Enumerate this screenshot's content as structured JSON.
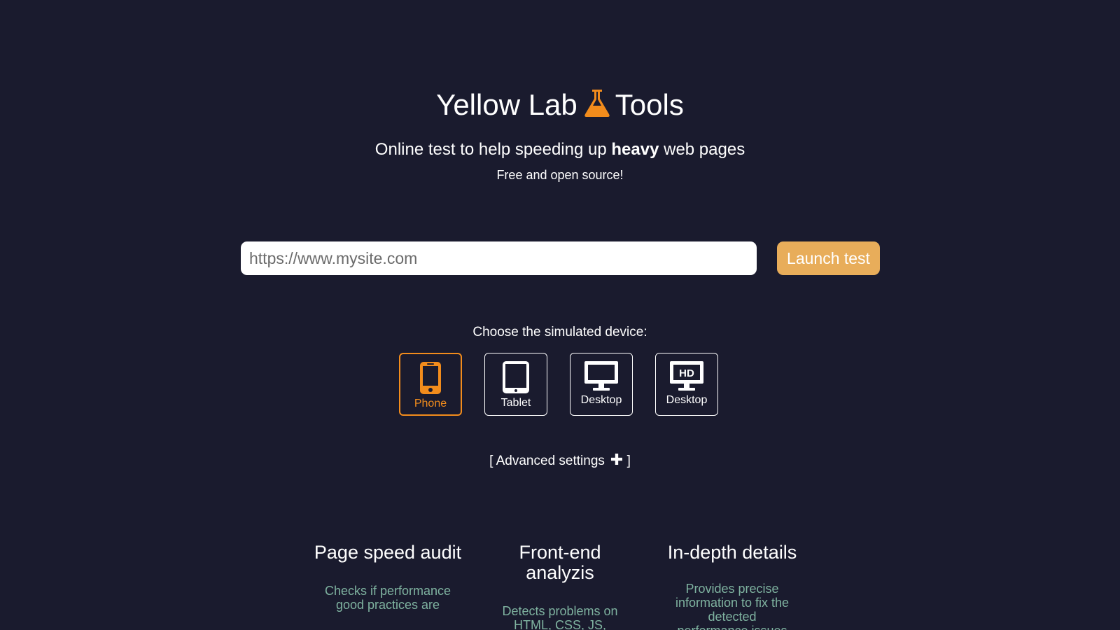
{
  "header": {
    "title_part1": "Yellow Lab",
    "title_part2": "Tools",
    "subtitle_prefix": "Online test to help speeding up ",
    "subtitle_bold": "heavy",
    "subtitle_suffix": " web pages",
    "tagline": "Free and open source!"
  },
  "search": {
    "placeholder": "https://www.mysite.com",
    "value": "",
    "launch_label": "Launch test"
  },
  "devices": {
    "label": "Choose the simulated device:",
    "selected": "Phone",
    "items": [
      {
        "label": "Phone",
        "icon": "phone-icon"
      },
      {
        "label": "Tablet",
        "icon": "tablet-icon"
      },
      {
        "label": "Desktop",
        "icon": "desktop-icon"
      },
      {
        "label": "Desktop",
        "icon": "desktop-hd-icon",
        "badge": "HD"
      }
    ]
  },
  "advanced": {
    "open": "[",
    "label": "Advanced settings",
    "icon": "plus-icon",
    "close": "]"
  },
  "features": [
    {
      "title": "Page speed audit",
      "text": "Checks if performance good practices are"
    },
    {
      "title": "Front-end analyzis",
      "text": "Detects problems on HTML, CSS, JS,"
    },
    {
      "title": "In-depth details",
      "text": "Provides precise information to fix the detected performance issues"
    }
  ],
  "colors": {
    "background": "#1a1b2e",
    "accent": "#f28c1c",
    "button": "#e8ad5a",
    "feature_text": "#7fb3a0"
  }
}
